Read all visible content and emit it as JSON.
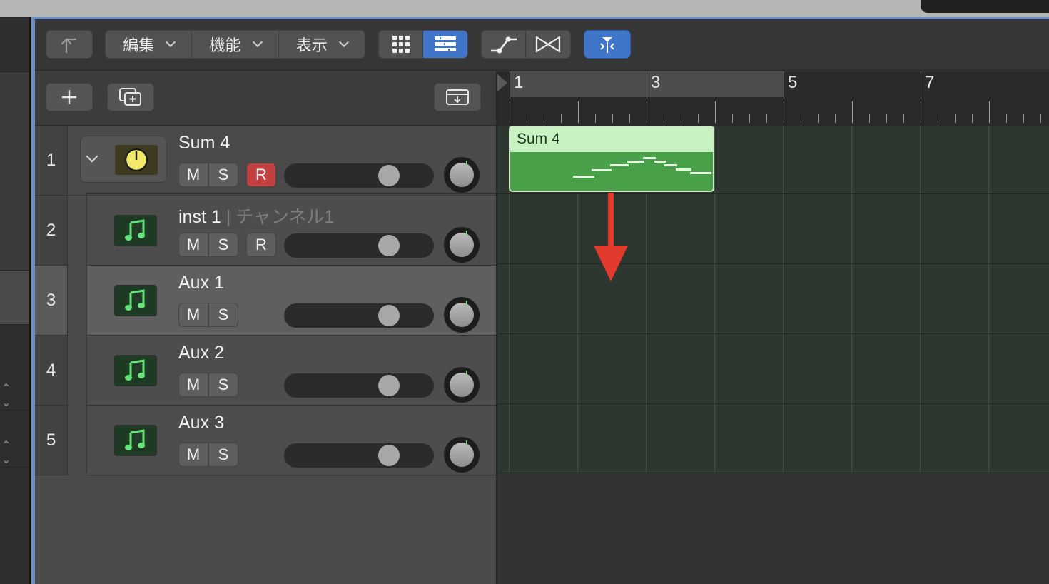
{
  "toolbar": {
    "menus": [
      {
        "label": "編集"
      },
      {
        "label": "機能"
      },
      {
        "label": "表示"
      }
    ]
  },
  "ruler": {
    "bars": [
      "1",
      "3",
      "5",
      "7"
    ]
  },
  "tracks": [
    {
      "number": "1",
      "name": "Sum 4",
      "sub": "",
      "m_label": "M",
      "s_label": "S",
      "r_label": "R",
      "icon": "meter-icon"
    },
    {
      "number": "2",
      "name": "inst 1",
      "sub": " | チャンネル1",
      "m_label": "M",
      "s_label": "S",
      "r_label": "R",
      "icon": "music-note-icon"
    },
    {
      "number": "3",
      "name": "Aux 1",
      "sub": "",
      "m_label": "M",
      "s_label": "S",
      "icon": "music-note-icon"
    },
    {
      "number": "4",
      "name": "Aux 2",
      "sub": "",
      "m_label": "M",
      "s_label": "S",
      "icon": "music-note-icon"
    },
    {
      "number": "5",
      "name": "Aux 3",
      "sub": "",
      "m_label": "M",
      "s_label": "S",
      "icon": "music-note-icon"
    }
  ],
  "region": {
    "name": "Sum 4"
  },
  "colors": {
    "accent_blue": "#3f76c9",
    "record_red": "#c34040",
    "region_green": "#48a048",
    "region_header": "#c8f2c2",
    "arrow_red": "#e23b2e"
  }
}
